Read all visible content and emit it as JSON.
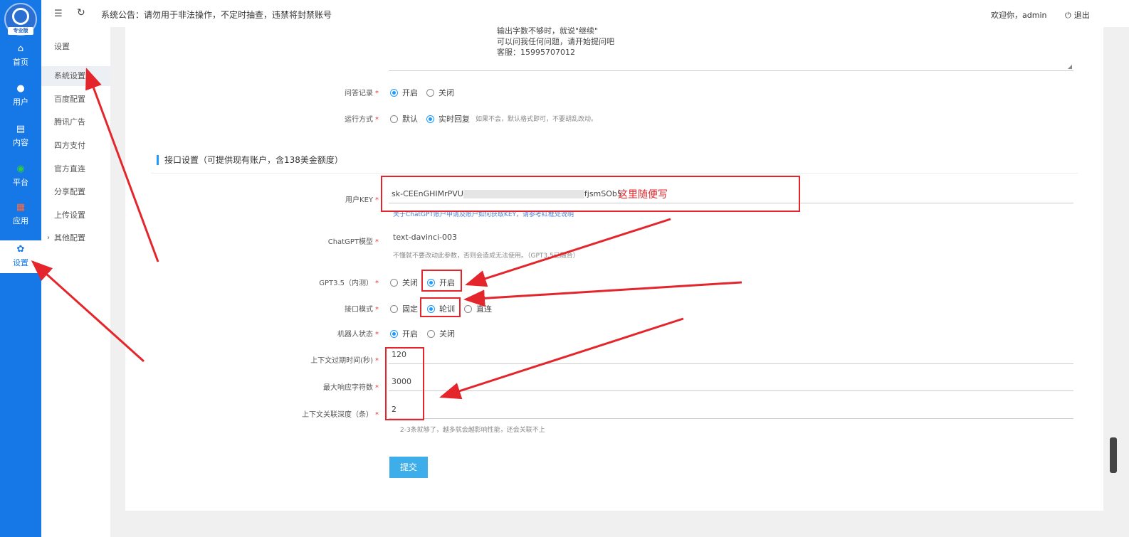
{
  "sidebar": {
    "logo_tag": "专业版",
    "items": [
      {
        "label": "首页",
        "icon": "home-icon"
      },
      {
        "label": "用户",
        "icon": "user-icon"
      },
      {
        "label": "内容",
        "icon": "document-icon"
      },
      {
        "label": "平台",
        "icon": "platform-icon"
      },
      {
        "label": "应用",
        "icon": "apps-icon"
      },
      {
        "label": "设置",
        "icon": "gear-icon"
      }
    ]
  },
  "subnav": {
    "items": [
      "设置",
      "系统设置",
      "百度配置",
      "腾讯广告",
      "四方支付",
      "官方直连",
      "分享配置",
      "上传设置",
      "其他配置"
    ],
    "chevron": "›"
  },
  "topbar": {
    "notice": "系统公告：请勿用于非法操作，不定时抽查，违禁将封禁账号",
    "welcome": "欢迎你，admin",
    "logout": "退出"
  },
  "textarea": {
    "lines": [
      "输出字数不够时，就说\"继续\"",
      "可以问我任何问题，请开始提问吧",
      "客服：15995707012"
    ]
  },
  "form": {
    "qa_record": {
      "label": "问答记录",
      "options": [
        "开启",
        "关闭"
      ]
    },
    "run_mode": {
      "label": "运行方式",
      "options": [
        "默认",
        "实时回复"
      ],
      "hint": "如果不会，默认格式即可，不要胡乱改动。"
    },
    "section_title": "接口设置（可提供现有账户，含138美金额度）",
    "user_key": {
      "label": "用户KEY",
      "value_start": "sk-CEEnGHIMrPVU",
      "value_end": "fjsmSOb5",
      "hint": "关于ChatGPT账户申请及账户如何获取KEY，请参考红框处说明"
    },
    "model": {
      "label": "ChatGPT模型",
      "value": "text-davinci-003",
      "hint": "不懂就不要改动此参数，否则会造成无法使用。（GPT3.5已融合）"
    },
    "gpt35": {
      "label": "GPT3.5（内测）",
      "options": [
        "关闭",
        "开启"
      ]
    },
    "api_mode": {
      "label": "接口模式",
      "options": [
        "固定",
        "轮训",
        "直连"
      ]
    },
    "bot_state": {
      "label": "机器人状态",
      "options": [
        "开启",
        "关闭"
      ]
    },
    "context_expire": {
      "label": "上下文过期时间(秒)",
      "value": "120"
    },
    "max_chars": {
      "label": "最大响应字符数",
      "value": "3000"
    },
    "context_depth": {
      "label": "上下文关联深度（条）",
      "value": "2",
      "hint": "2-3条就够了，越多就会越影响性能，还会关联不上"
    },
    "required_mark": "*",
    "submit": "提交"
  },
  "annotation": {
    "note": "这里随便写",
    "color": "#e4262c"
  },
  "colors": {
    "sidebar": "#1677e6",
    "accent": "#1e9bff",
    "submit": "#3daeea"
  }
}
